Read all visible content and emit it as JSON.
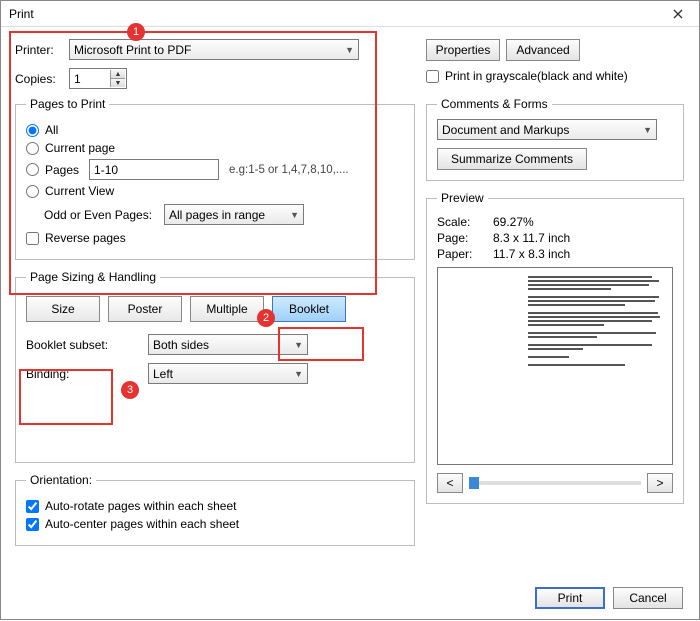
{
  "window": {
    "title": "Print"
  },
  "printer": {
    "label": "Printer:",
    "value": "Microsoft Print to PDF",
    "copies_label": "Copies:",
    "copies_value": "1",
    "properties_btn": "Properties",
    "advanced_btn": "Advanced",
    "grayscale_label": "Print in grayscale(black and white)"
  },
  "pages": {
    "legend": "Pages to Print",
    "all": "All",
    "current": "Current page",
    "pages": "Pages",
    "pages_value": "1-10",
    "pages_hint": "e.g:1-5 or 1,4,7,8,10,....",
    "current_view": "Current View",
    "odd_even_label": "Odd or Even Pages:",
    "odd_even_value": "All pages in range",
    "reverse": "Reverse pages"
  },
  "sizing": {
    "legend": "Page Sizing & Handling",
    "size": "Size",
    "poster": "Poster",
    "multiple": "Multiple",
    "booklet": "Booklet",
    "subset_label": "Booklet subset:",
    "subset_value": "Both sides",
    "binding_label": "Binding:",
    "binding_value": "Left"
  },
  "orientation": {
    "legend": "Orientation:",
    "autorotate": "Auto-rotate pages within each sheet",
    "autocenter": "Auto-center pages within each sheet"
  },
  "comments": {
    "legend": "Comments & Forms",
    "value": "Document and Markups",
    "summarize": "Summarize Comments"
  },
  "preview": {
    "legend": "Preview",
    "scale_label": "Scale:",
    "scale_value": "69.27%",
    "page_label": "Page:",
    "page_value": "8.3 x 11.7 inch",
    "paper_label": "Paper:",
    "paper_value": "11.7 x 8.3 inch",
    "prev": "<",
    "next": ">"
  },
  "footer": {
    "print": "Print",
    "cancel": "Cancel"
  },
  "annotations": {
    "n1": "1",
    "n2": "2",
    "n3": "3"
  }
}
